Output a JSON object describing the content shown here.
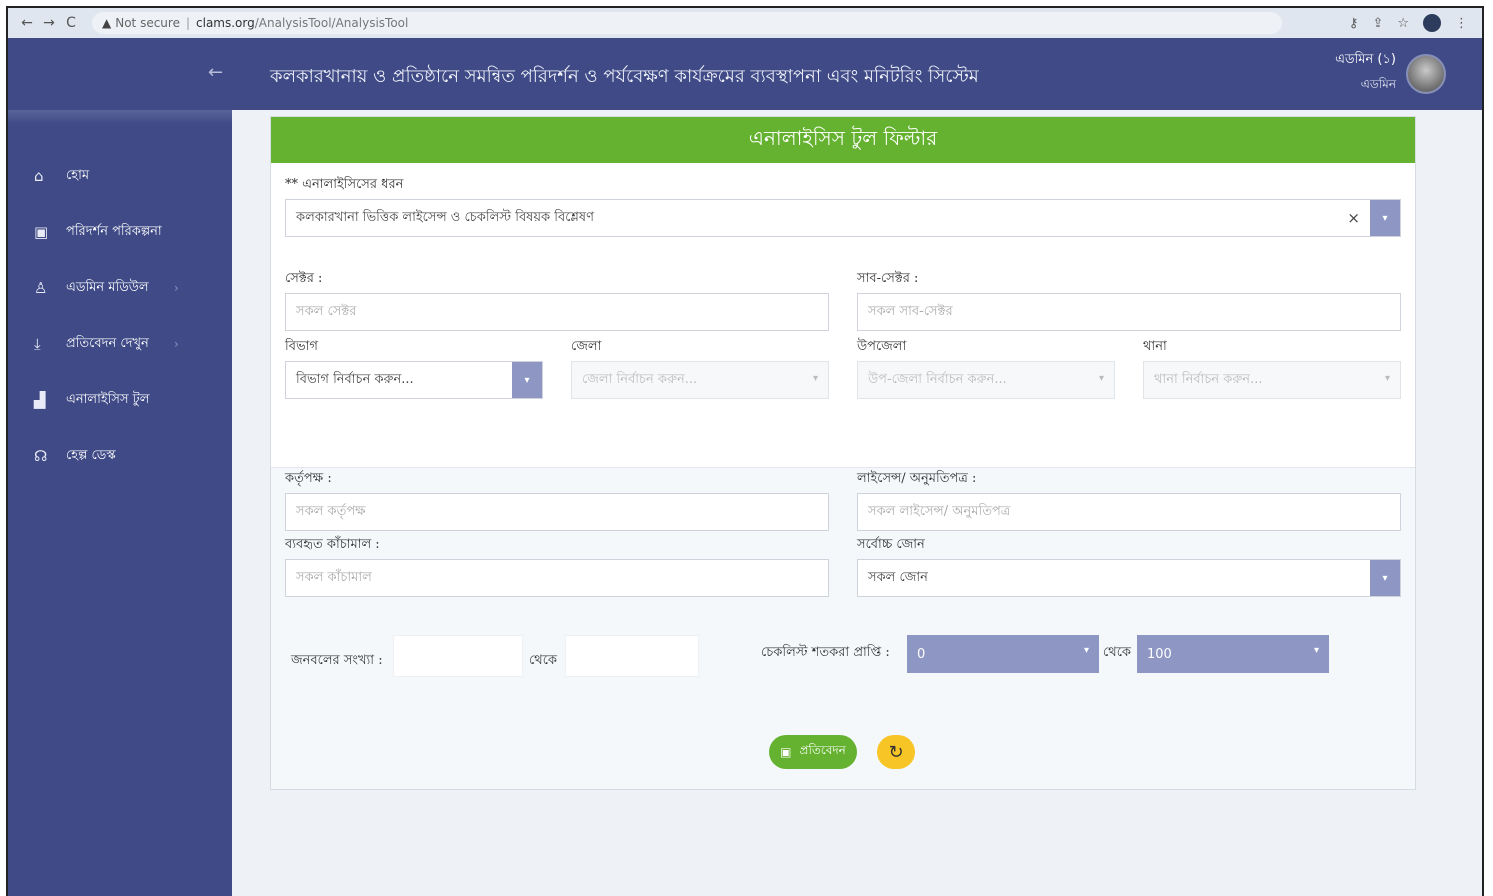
{
  "browser": {
    "back": "←",
    "forward": "→",
    "reload": "C",
    "security": "Not secure",
    "host": "clams.org",
    "path": "/AnalysisTool/AnalysisTool"
  },
  "header": {
    "title": "কলকারখানায় ও প্রতিষ্ঠানে সমন্বিত পরিদর্শন ও পর্যবেক্ষণ কার্যক্রমের ব্যবস্থাপনা এবং মনিটরিং সিস্টেম",
    "user_name": "এডমিন (১)",
    "user_role": "এডমিন"
  },
  "sidebar": {
    "items": [
      {
        "label": "হোম",
        "icon": "home-icon",
        "glyph": "⌂",
        "has_chevron": false
      },
      {
        "label": "পরিদর্শন পরিকল্পনা",
        "icon": "calendar-icon",
        "glyph": "▣",
        "has_chevron": false
      },
      {
        "label": "এডমিন মডিউল",
        "icon": "user-icon",
        "glyph": "♙",
        "has_chevron": true
      },
      {
        "label": "প্রতিবেদন দেখুন",
        "icon": "download-icon",
        "glyph": "⤓",
        "has_chevron": true
      },
      {
        "label": "এনালাইসিস টুল",
        "icon": "bar-chart-icon",
        "glyph": "▟",
        "has_chevron": false
      },
      {
        "label": "হেল্প ডেস্ক",
        "icon": "headset-icon",
        "glyph": "☊",
        "has_chevron": false
      }
    ],
    "chevron": "›"
  },
  "panel": {
    "title": "এনালাইসিস টুল ফিল্টার",
    "analysis_type_label": "** এনালাইসিসের ধরন",
    "analysis_type_value": "কলকারখানা ভিত্তিক লাইসেন্স ও চেকলিস্ট বিষয়ক বিশ্লেষণ",
    "sector_label": "সেক্টর :",
    "sector_placeholder": "সকল সেক্টর",
    "subsector_label": "সাব-সেক্টর :",
    "subsector_placeholder": "সকল সাব-সেক্টর",
    "division_label": "বিভাগ",
    "division_placeholder": "বিভাগ নির্বাচন করুন...",
    "district_label": "জেলা",
    "district_placeholder": "জেলা নির্বাচন করুন...",
    "upazila_label": "উপজেলা",
    "upazila_placeholder": "উপ-জেলা নির্বাচন করুন...",
    "thana_label": "থানা",
    "thana_placeholder": "থানা নির্বাচন করুন...",
    "authority_label": "কর্তৃপক্ষ :",
    "authority_placeholder": "সকল কর্তৃপক্ষ",
    "license_label": "লাইসেন্স/ অনুমতিপত্র :",
    "license_placeholder": "সকল লাইসেন্স/ অনুমতিপত্র",
    "rawmat_label": "ব্যবহৃত কাঁচামাল :",
    "rawmat_placeholder": "সকল কাঁচামাল",
    "zone_label": "সর্বোচ্চ জোন",
    "zone_value": "সকল জোন",
    "workers_label": "জনবলের সংখ্যা :",
    "from_word": "থেকে",
    "checklist_label": "চেকলিস্ট শতকরা প্রাপ্তি :",
    "range_min": "0",
    "range_max": "100",
    "report_button": "প্রতিবেদন",
    "reset_glyph": "↻",
    "clear_glyph": "×",
    "dropdown_glyph": "▾"
  }
}
